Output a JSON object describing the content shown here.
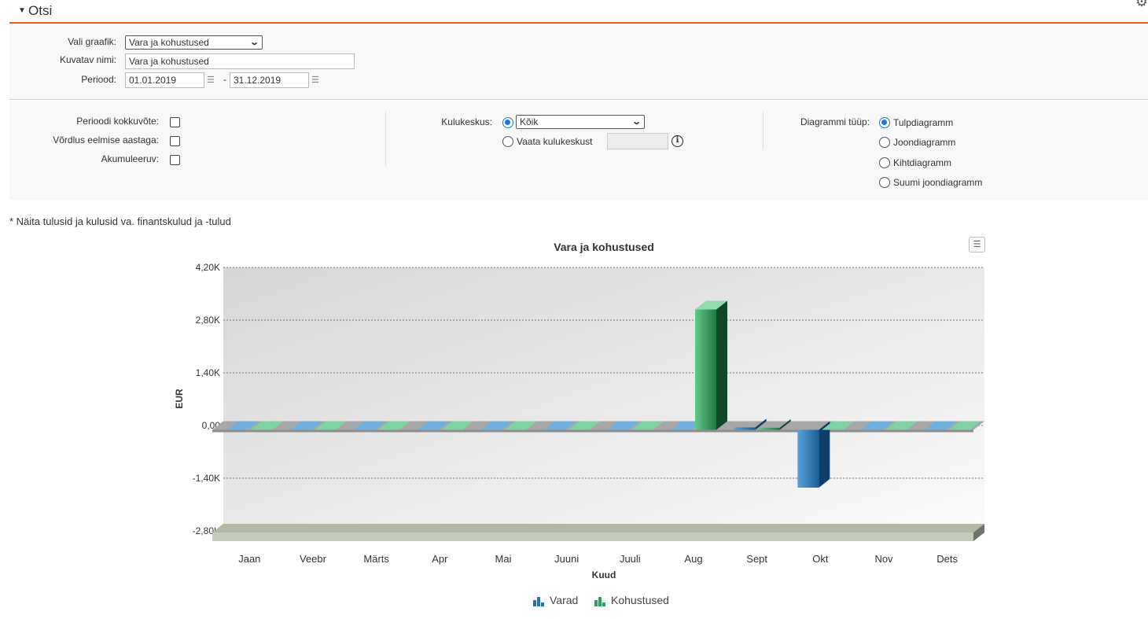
{
  "header": {
    "title": "Otsi",
    "collapse_icon": "triangle-down",
    "settings_icon": "gears-icon"
  },
  "form": {
    "graph_label": "Vali graafik:",
    "graph_value": "Vara ja kohustused",
    "name_label": "Kuvatav nimi:",
    "name_value": "Vara ja kohustused",
    "period_label": "Periood:",
    "period_from": "01.01.2019",
    "period_sep": "-",
    "period_to": "31.12.2019"
  },
  "options": {
    "summary_label": "Perioodi kokkuvõte:",
    "compare_label": "Võrdlus eelmise aastaga:",
    "cumulative_label": "Akumuleeruv:",
    "costcenter_label": "Kulukeskus:",
    "costcenter_all": "Kõik",
    "costcenter_view": "Vaata kulukeskust",
    "chart_type_label": "Diagrammi tüüp:",
    "chart_types": [
      "Tulpdiagramm",
      "Joondiagramm",
      "Kihtdiagramm",
      "Suumi joondiagramm"
    ],
    "chart_type_selected": 0
  },
  "note": "* Näita tulusid ja kulusid va. finantskulud ja -tulud",
  "colors": {
    "accent": "#e8591a",
    "varad": "#1f77b4",
    "kohustused": "#2ca25f",
    "radio": "#1a73e8"
  },
  "chart_data": {
    "type": "bar",
    "title": "Vara ja kohustused",
    "xlabel": "Kuud",
    "ylabel": "EUR",
    "categories": [
      "Jaan",
      "Veebr",
      "Märts",
      "Apr",
      "Mai",
      "Juuni",
      "Juuli",
      "Aug",
      "Sept",
      "Okt",
      "Nov",
      "Dets"
    ],
    "ylim": [
      -2800,
      4200
    ],
    "yticks": [
      4200,
      2800,
      1400,
      0,
      -1400,
      -2800
    ],
    "ytick_labels": [
      "4,20K",
      "2,80K",
      "1,40K",
      "0,00",
      "-1,40K",
      "-2,80K"
    ],
    "series": [
      {
        "name": "Varad",
        "values": [
          0,
          0,
          0,
          0,
          0,
          0,
          0,
          0,
          -50,
          -1650,
          0,
          0
        ]
      },
      {
        "name": "Kohustused",
        "values": [
          0,
          0,
          0,
          0,
          0,
          0,
          0,
          3200,
          -60,
          0,
          0,
          0
        ]
      }
    ],
    "legend": "bottom-center",
    "grid": true
  }
}
